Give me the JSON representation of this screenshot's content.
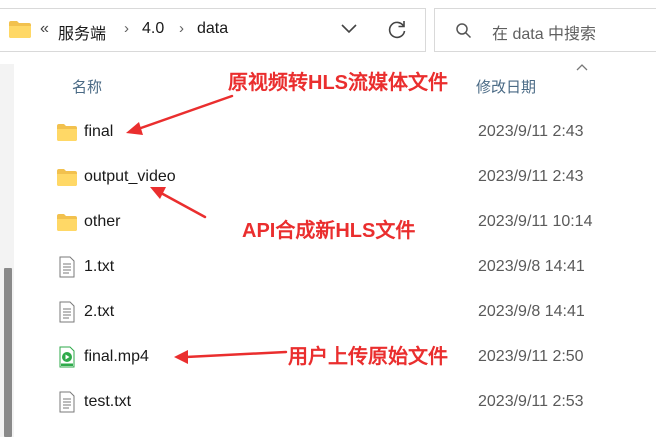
{
  "address_bar": {
    "crumbs": [
      "服务端",
      "4.0",
      "data"
    ],
    "overflow_label": "«"
  },
  "search": {
    "placeholder": "在 data 中搜索"
  },
  "columns": {
    "name": "名称",
    "date_modified": "修改日期"
  },
  "files": [
    {
      "name": "final",
      "date": "2023/9/11 2:43",
      "type": "folder"
    },
    {
      "name": "output_video",
      "date": "2023/9/11 2:43",
      "type": "folder"
    },
    {
      "name": "other",
      "date": "2023/9/11 10:14",
      "type": "folder"
    },
    {
      "name": "1.txt",
      "date": "2023/9/8 14:41",
      "type": "text"
    },
    {
      "name": "2.txt",
      "date": "2023/9/8 14:41",
      "type": "text"
    },
    {
      "name": "final.mp4",
      "date": "2023/9/11 2:50",
      "type": "video"
    },
    {
      "name": "test.txt",
      "date": "2023/9/11 2:53",
      "type": "text"
    }
  ],
  "annotations": {
    "hls_source": "原视频转HLS流媒体文件",
    "api_merge": "API合成新HLS文件",
    "user_upload": "用户上传原始文件"
  },
  "colors": {
    "annotation": "#ea2e2e",
    "folder": "#f2c14e",
    "video_icon": "#2eaa4a",
    "header_text": "#4a6a85"
  },
  "icons": {
    "folder": "folder-icon",
    "text": "text-file-icon",
    "video": "video-file-icon",
    "search": "search-icon",
    "refresh": "refresh-icon",
    "dropdown": "chevron-down-icon"
  }
}
